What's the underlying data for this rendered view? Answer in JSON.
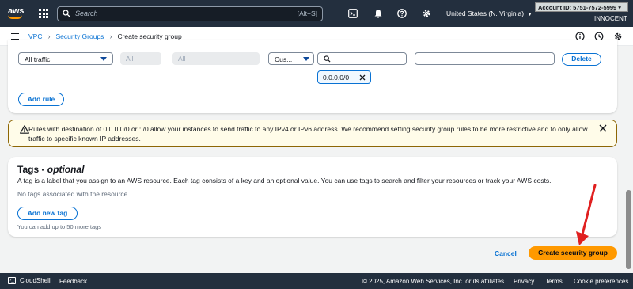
{
  "topnav": {
    "logo": "aws",
    "search_placeholder": "Search",
    "search_shortcut": "[Alt+S]",
    "region": "United States (N. Virginia)",
    "account_badge": "Account ID: 5751-7572-5999",
    "user": "INNOCENT",
    "icons": [
      "services-grid-icon",
      "search-icon",
      "cloudshell-icon",
      "bell-icon",
      "help-icon",
      "gear-icon"
    ]
  },
  "breadcrumb": {
    "items": [
      "VPC",
      "Security Groups"
    ],
    "current": "Create security group"
  },
  "rule": {
    "type": "All traffic",
    "protocol": "All",
    "port_range": "All",
    "source_type": "Cus...",
    "source_token": "0.0.0.0/0",
    "description": "",
    "delete_label": "Delete",
    "add_rule_label": "Add rule"
  },
  "warning": {
    "text": "Rules with destination of 0.0.0.0/0 or ::/0 allow your instances to send traffic to any IPv4 or IPv6 address. We recommend setting security group rules to be more restrictive and to only allow traffic to specific known IP addresses."
  },
  "tags": {
    "title": "Tags - ",
    "title_optional": "optional",
    "description": "A tag is a label that you assign to an AWS resource. Each tag consists of a key and an optional value. You can use tags to search and filter your resources or track your AWS costs.",
    "empty_text": "No tags associated with the resource.",
    "add_label": "Add new tag",
    "limit_text": "You can add up to 50 more tags"
  },
  "actions": {
    "cancel_label": "Cancel",
    "create_label": "Create security group"
  },
  "footer": {
    "cloudshell": "CloudShell",
    "feedback": "Feedback",
    "copyright": "© 2025, Amazon Web Services, Inc. or its affiliates.",
    "privacy": "Privacy",
    "terms": "Terms",
    "cookies": "Cookie preferences"
  },
  "colors": {
    "nav_bg": "#232f3e",
    "link": "#0972d3",
    "primary_button": "#ff9900",
    "warning_border": "#8d6605",
    "annotation_arrow": "#e02020"
  }
}
